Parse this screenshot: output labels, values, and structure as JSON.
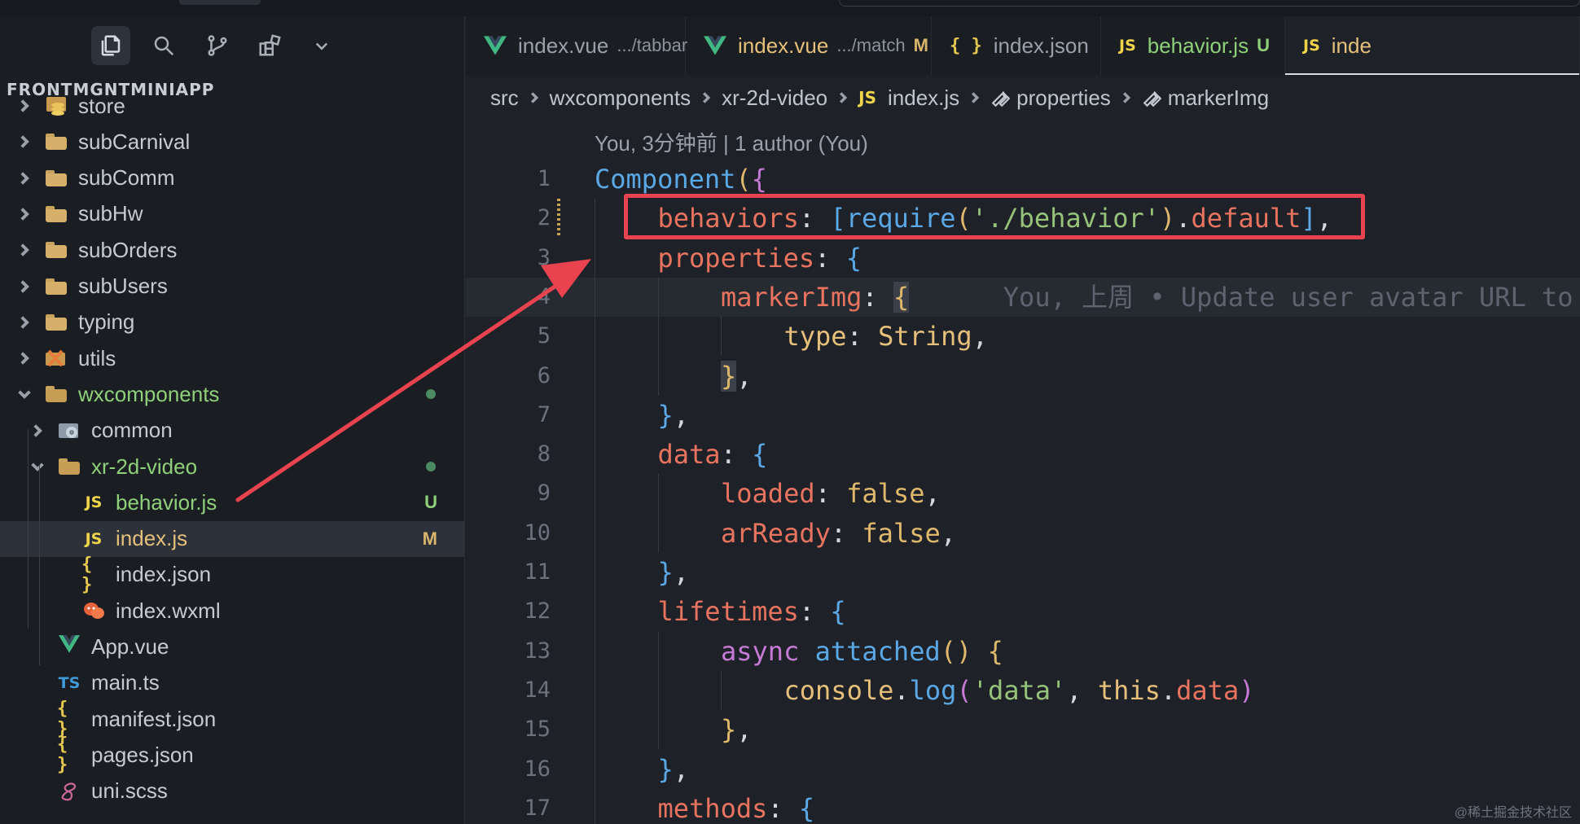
{
  "explorer": {
    "title": "FRONTMGNTMINIAPP",
    "activity_icons": [
      "files-icon",
      "search-icon",
      "source-control-icon",
      "extensions-icon",
      "chevron-down-icon"
    ],
    "items": [
      {
        "label": "store",
        "kind": "folder-store",
        "depth": 0,
        "expanded": false
      },
      {
        "label": "subCarnival",
        "kind": "folder",
        "depth": 0,
        "expanded": false
      },
      {
        "label": "subComm",
        "kind": "folder",
        "depth": 0,
        "expanded": false
      },
      {
        "label": "subHw",
        "kind": "folder",
        "depth": 0,
        "expanded": false
      },
      {
        "label": "subOrders",
        "kind": "folder",
        "depth": 0,
        "expanded": false
      },
      {
        "label": "subUsers",
        "kind": "folder",
        "depth": 0,
        "expanded": false
      },
      {
        "label": "typing",
        "kind": "folder",
        "depth": 0,
        "expanded": false
      },
      {
        "label": "utils",
        "kind": "folder-utils",
        "depth": 0,
        "expanded": false
      },
      {
        "label": "wxcomponents",
        "kind": "folder-open",
        "depth": 0,
        "expanded": true,
        "color": "#8fd07a",
        "status": "dot"
      },
      {
        "label": "common",
        "kind": "folder-common",
        "depth": 1,
        "expanded": false
      },
      {
        "label": "xr-2d-video",
        "kind": "folder-open",
        "depth": 1,
        "expanded": true,
        "color": "#8fd07a",
        "status": "dot"
      },
      {
        "label": "behavior.js",
        "kind": "js",
        "depth": 2,
        "color": "#8fd07a",
        "badge": "U",
        "badge_color": "#8fd07a"
      },
      {
        "label": "index.js",
        "kind": "js",
        "depth": 2,
        "color": "#e6c07b",
        "badge": "M",
        "badge_color": "#d9b56b",
        "selected": true
      },
      {
        "label": "index.json",
        "kind": "json",
        "depth": 2
      },
      {
        "label": "index.wxml",
        "kind": "wxml",
        "depth": 2
      },
      {
        "label": "App.vue",
        "kind": "vue",
        "depth": 1
      },
      {
        "label": "main.ts",
        "kind": "ts",
        "depth": 1
      },
      {
        "label": "manifest.json",
        "kind": "json",
        "depth": 1
      },
      {
        "label": "pages.json",
        "kind": "json",
        "depth": 1
      },
      {
        "label": "uni.scss",
        "kind": "scss",
        "depth": 1
      }
    ]
  },
  "tabs": [
    {
      "icon": "vue",
      "label": "index.vue",
      "desc": ".../tabbar",
      "mark": "",
      "active": false
    },
    {
      "icon": "vue",
      "label": "index.vue",
      "desc": ".../match",
      "mark": "M",
      "mark_color": "#d9b56b",
      "label_color": "#e6c07b",
      "active": false
    },
    {
      "icon": "json",
      "label": "index.json",
      "desc": "",
      "mark": "",
      "active": false
    },
    {
      "icon": "js",
      "label": "behavior.js",
      "desc": "",
      "mark": "U",
      "mark_color": "#8fd07a",
      "label_color": "#8fd07a",
      "active": false
    },
    {
      "icon": "js",
      "label": "inde",
      "desc": "",
      "mark": "",
      "label_color": "#e6c07b",
      "active": true
    }
  ],
  "breadcrumb": {
    "src": "src",
    "wxcomponents": "wxcomponents",
    "folder": "xr-2d-video",
    "file": "index.js",
    "properties": "properties",
    "markerImg": "markerImg"
  },
  "blame": {
    "header": "You, 3分钟前 | 1 author (You)",
    "inline": "You, 上周 • Update user avatar URL to"
  },
  "code_lines": [
    {
      "n": "1",
      "indent": 0,
      "tokens": [
        [
          "fn",
          "Component"
        ],
        [
          "b1",
          "("
        ],
        [
          "b2",
          "{"
        ]
      ]
    },
    {
      "n": "2",
      "indent": 1,
      "tokens": [
        [
          "prop",
          "behaviors"
        ],
        [
          "plain",
          ": "
        ],
        [
          "b3",
          "["
        ],
        [
          "fn",
          "require"
        ],
        [
          "b1",
          "("
        ],
        [
          "str",
          "'./behavior'"
        ],
        [
          "b1",
          ")"
        ],
        [
          "plain",
          "."
        ],
        [
          "prop",
          "default"
        ],
        [
          "b3",
          "]"
        ],
        [
          "plain",
          ","
        ]
      ]
    },
    {
      "n": "3",
      "indent": 1,
      "tokens": [
        [
          "prop",
          "properties"
        ],
        [
          "plain",
          ": "
        ],
        [
          "b3",
          "{"
        ]
      ]
    },
    {
      "n": "4",
      "indent": 2,
      "tokens": [
        [
          "prop",
          "markerImg"
        ],
        [
          "plain",
          ": "
        ],
        [
          "b1hl",
          "{"
        ]
      ],
      "ghost": true,
      "highlight": true
    },
    {
      "n": "5",
      "indent": 3,
      "tokens": [
        [
          "key",
          "type"
        ],
        [
          "plain",
          ": "
        ],
        [
          "key",
          "String"
        ],
        [
          "plain",
          ","
        ]
      ]
    },
    {
      "n": "6",
      "indent": 2,
      "tokens": [
        [
          "b1hl",
          "}"
        ],
        [
          "plain",
          ","
        ]
      ]
    },
    {
      "n": "7",
      "indent": 1,
      "tokens": [
        [
          "b3",
          "}"
        ],
        [
          "plain",
          ","
        ]
      ]
    },
    {
      "n": "8",
      "indent": 1,
      "tokens": [
        [
          "prop",
          "data"
        ],
        [
          "plain",
          ": "
        ],
        [
          "b3",
          "{"
        ]
      ]
    },
    {
      "n": "9",
      "indent": 2,
      "tokens": [
        [
          "prop",
          "loaded"
        ],
        [
          "plain",
          ": "
        ],
        [
          "bool",
          "false"
        ],
        [
          "plain",
          ","
        ]
      ]
    },
    {
      "n": "10",
      "indent": 2,
      "tokens": [
        [
          "prop",
          "arReady"
        ],
        [
          "plain",
          ": "
        ],
        [
          "bool",
          "false"
        ],
        [
          "plain",
          ","
        ]
      ]
    },
    {
      "n": "11",
      "indent": 1,
      "tokens": [
        [
          "b3",
          "}"
        ],
        [
          "plain",
          ","
        ]
      ]
    },
    {
      "n": "12",
      "indent": 1,
      "tokens": [
        [
          "prop",
          "lifetimes"
        ],
        [
          "plain",
          ": "
        ],
        [
          "b3",
          "{"
        ]
      ]
    },
    {
      "n": "13",
      "indent": 2,
      "tokens": [
        [
          "kw",
          "async "
        ],
        [
          "fn",
          "attached"
        ],
        [
          "b1",
          "() {"
        ]
      ]
    },
    {
      "n": "14",
      "indent": 3,
      "tokens": [
        [
          "key",
          "console"
        ],
        [
          "plain",
          "."
        ],
        [
          "fn",
          "log"
        ],
        [
          "b2",
          "("
        ],
        [
          "str",
          "'data'"
        ],
        [
          "plain",
          ", "
        ],
        [
          "key",
          "this"
        ],
        [
          "plain",
          "."
        ],
        [
          "prop",
          "data"
        ],
        [
          "b2",
          ")"
        ]
      ]
    },
    {
      "n": "15",
      "indent": 2,
      "tokens": [
        [
          "b1",
          "}"
        ],
        [
          "plain",
          ","
        ]
      ]
    },
    {
      "n": "16",
      "indent": 1,
      "tokens": [
        [
          "b3",
          "}"
        ],
        [
          "plain",
          ","
        ]
      ]
    },
    {
      "n": "17",
      "indent": 1,
      "tokens": [
        [
          "prop",
          "methods"
        ],
        [
          "plain",
          ": "
        ],
        [
          "b3",
          "{"
        ]
      ]
    }
  ],
  "watermark": "@稀土掘金技术社区",
  "colors": {
    "annotation_red": "#e8434f",
    "accent_green": "#8fd07a",
    "modified_yellow": "#d9b56b"
  }
}
